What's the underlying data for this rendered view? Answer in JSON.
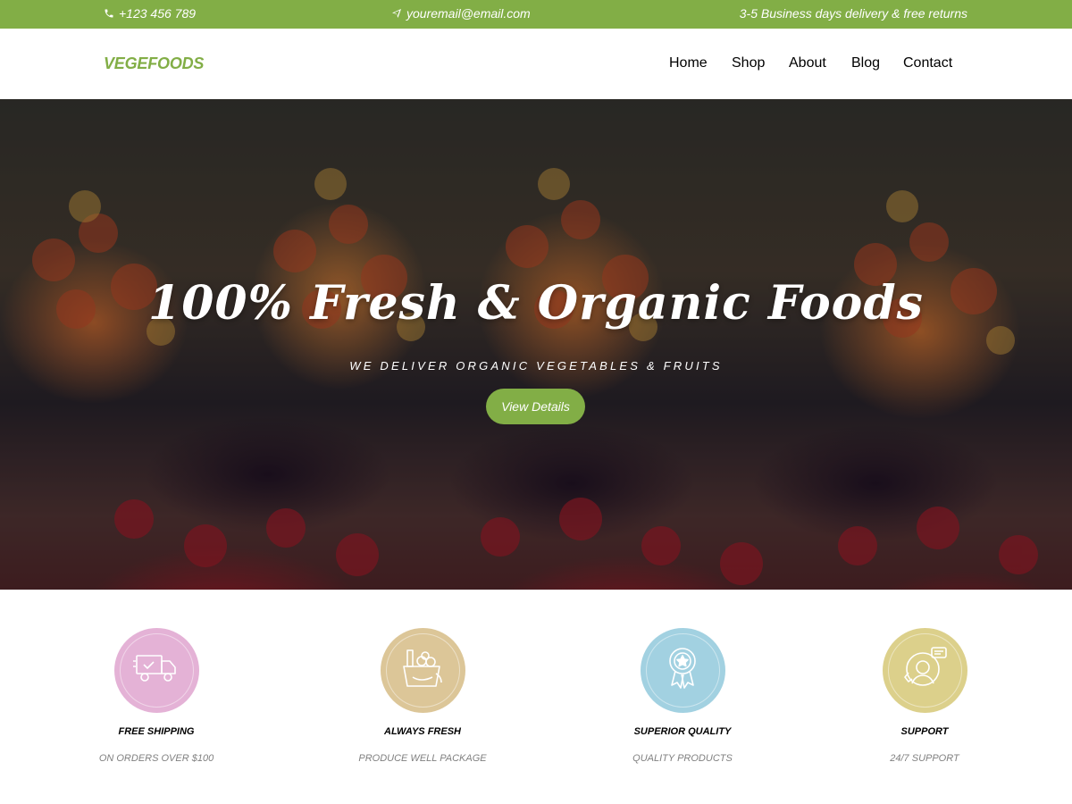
{
  "topbar": {
    "phone": "+123 456 789",
    "email": "youremail@email.com",
    "delivery": "3-5 Business days delivery & free returns",
    "phone_icon": "phone-icon",
    "email_icon": "paper-plane-icon",
    "bg_color": "#82ae46"
  },
  "header": {
    "logo": "VEGEFOODS",
    "nav": [
      "Home",
      "Shop",
      "About",
      "Blog",
      "Contact"
    ]
  },
  "hero": {
    "title": "100% Fresh & Organic Foods",
    "subtitle": "WE DELIVER ORGANIC VEGETABLES & FRUITS",
    "button_label": "View Details",
    "accent": "#82ae46"
  },
  "features": [
    {
      "title": "FREE SHIPPING",
      "subtitle": "ON ORDERS OVER $100",
      "icon": "truck-icon",
      "color": "#e4b2d6"
    },
    {
      "title": "ALWAYS FRESH",
      "subtitle": "PRODUCE WELL PACKAGE",
      "icon": "grocery-bag-icon",
      "color": "#dcc698"
    },
    {
      "title": "SUPERIOR QUALITY",
      "subtitle": "QUALITY PRODUCTS",
      "icon": "award-badge-icon",
      "color": "#a2d1e1"
    },
    {
      "title": "SUPPORT",
      "subtitle": "24/7 SUPPORT",
      "icon": "support-agent-icon",
      "color": "#dcd08b"
    }
  ]
}
